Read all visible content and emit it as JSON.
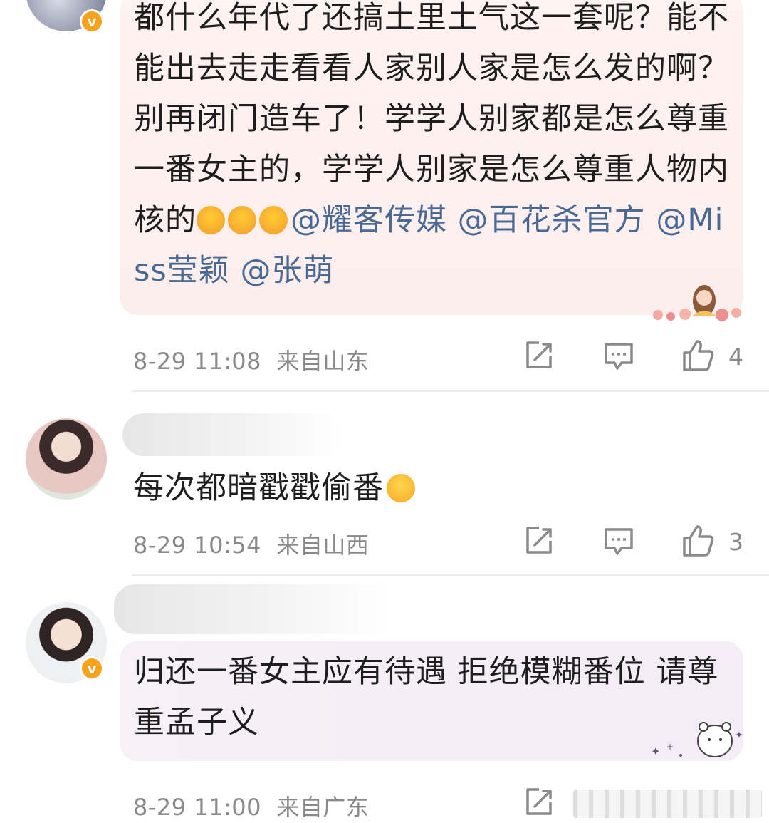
{
  "comments": [
    {
      "text_part1": "都什么年代了还搞土里土气这一套呢？能不能出去走走看看人家别人家是怎么发的啊？别再闭门造车了！学学人别家都是怎么尊重一番女主的，学学人别家是怎么尊重人物内核的",
      "emoji_name": "hug-emoji",
      "mentions": [
        "@耀客传媒",
        "@百花杀官方",
        "@Miss莹颖",
        "@张萌"
      ],
      "time": "8-29 11:08",
      "location": "来自山东",
      "likes": "4",
      "verified": true
    },
    {
      "text": "每次都暗戳戳偷番",
      "emoji_name": "sweat-smile-emoji",
      "time": "8-29 10:54",
      "location": "来自山西",
      "likes": "3",
      "verified": false
    },
    {
      "text": "归还一番女主应有待遇 拒绝模糊番位 请尊重孟子义",
      "time": "8-29 11:00",
      "location": "来自广东",
      "verified": true
    }
  ],
  "colors": {
    "mention": "#4a6a96",
    "meta": "#8a8a8a",
    "verified_badge": "#f7a21b",
    "bubble1_bg": "#fdf0ee",
    "bubble3_bg": "#f6eef6"
  },
  "icons": [
    "repost-icon",
    "comment-icon",
    "like-icon",
    "verified-badge-icon"
  ]
}
